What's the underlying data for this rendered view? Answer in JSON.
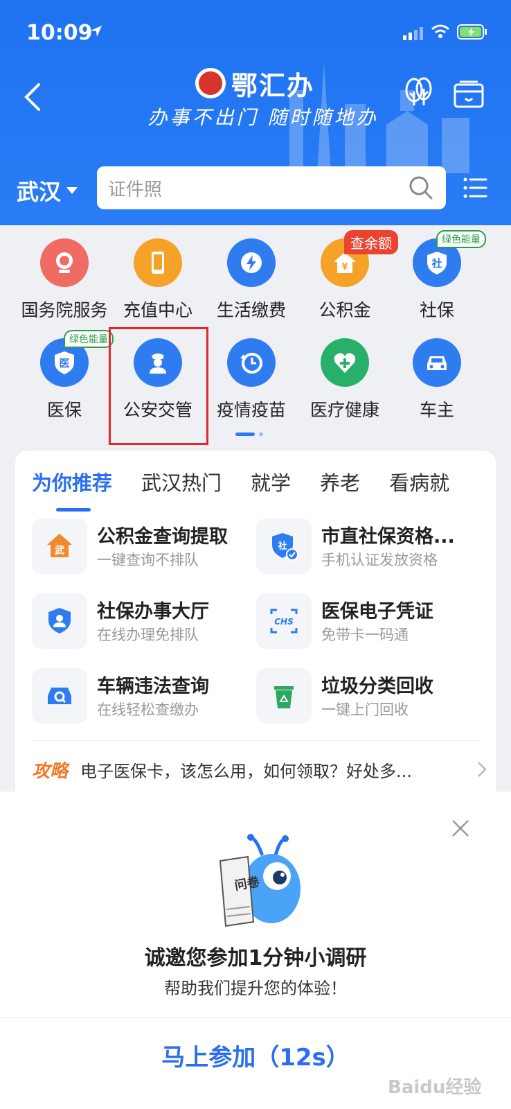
{
  "status": {
    "time": "10:09"
  },
  "header": {
    "app_name": "鄂汇办",
    "slogan": "办事不出门 随时随地办"
  },
  "city": "武汉",
  "search": {
    "placeholder": "证件照"
  },
  "grid": [
    {
      "label": "国务院服务",
      "color": "#f06b64",
      "icon": "state-council-icon"
    },
    {
      "label": "充值中心",
      "color": "#f6a229",
      "icon": "phone-icon"
    },
    {
      "label": "生活缴费",
      "color": "#2f7cf1",
      "icon": "lightning-icon"
    },
    {
      "label": "公积金",
      "color": "#f6a229",
      "icon": "house-fund-icon",
      "badge": "查余额"
    },
    {
      "label": "社保",
      "color": "#2f7cf1",
      "icon": "social-security-icon",
      "badge": "绿色能量"
    },
    {
      "label": "医保",
      "color": "#2f7cf1",
      "icon": "medical-insurance-icon",
      "badge": "绿色能量"
    },
    {
      "label": "公安交管",
      "color": "#2f7cf1",
      "icon": "police-icon"
    },
    {
      "label": "疫情疫苗",
      "color": "#2f7cf1",
      "icon": "clock-icon"
    },
    {
      "label": "医疗健康",
      "color": "#28b06a",
      "icon": "health-icon"
    },
    {
      "label": "车主",
      "color": "#2f7cf1",
      "icon": "car-icon"
    }
  ],
  "tabs": [
    "为你推荐",
    "武汉热门",
    "就学",
    "养老",
    "看病就"
  ],
  "services": [
    {
      "title": "公积金查询提取",
      "sub": "一键查询不排队",
      "icon": "house-fund-icon",
      "icon_text": "武"
    },
    {
      "title": "市直社保资格...",
      "sub": "手机认证发放资格",
      "icon": "shield-check-icon",
      "icon_text": "社"
    },
    {
      "title": "社保办事大厅",
      "sub": "在线办理免排队",
      "icon": "shield-user-icon"
    },
    {
      "title": "医保电子凭证",
      "sub": "免带卡一码通",
      "icon": "chs-icon",
      "icon_text": "CHS"
    },
    {
      "title": "车辆违法查询",
      "sub": "在线轻松查缴办",
      "icon": "car-search-icon"
    },
    {
      "title": "垃圾分类回收",
      "sub": "一键上门回收",
      "icon": "recycle-bin-icon"
    }
  ],
  "tip": {
    "tag": "攻略",
    "text": "电子医保卡，该怎么用，如何领取？好处多..."
  },
  "survey": {
    "mascot_text": "问卷",
    "title": "诚邀您参加1分钟小调研",
    "subtitle": "帮助我们提升您的体验！",
    "button": "马上参加（12s）"
  },
  "watermark": "Baidu经验"
}
